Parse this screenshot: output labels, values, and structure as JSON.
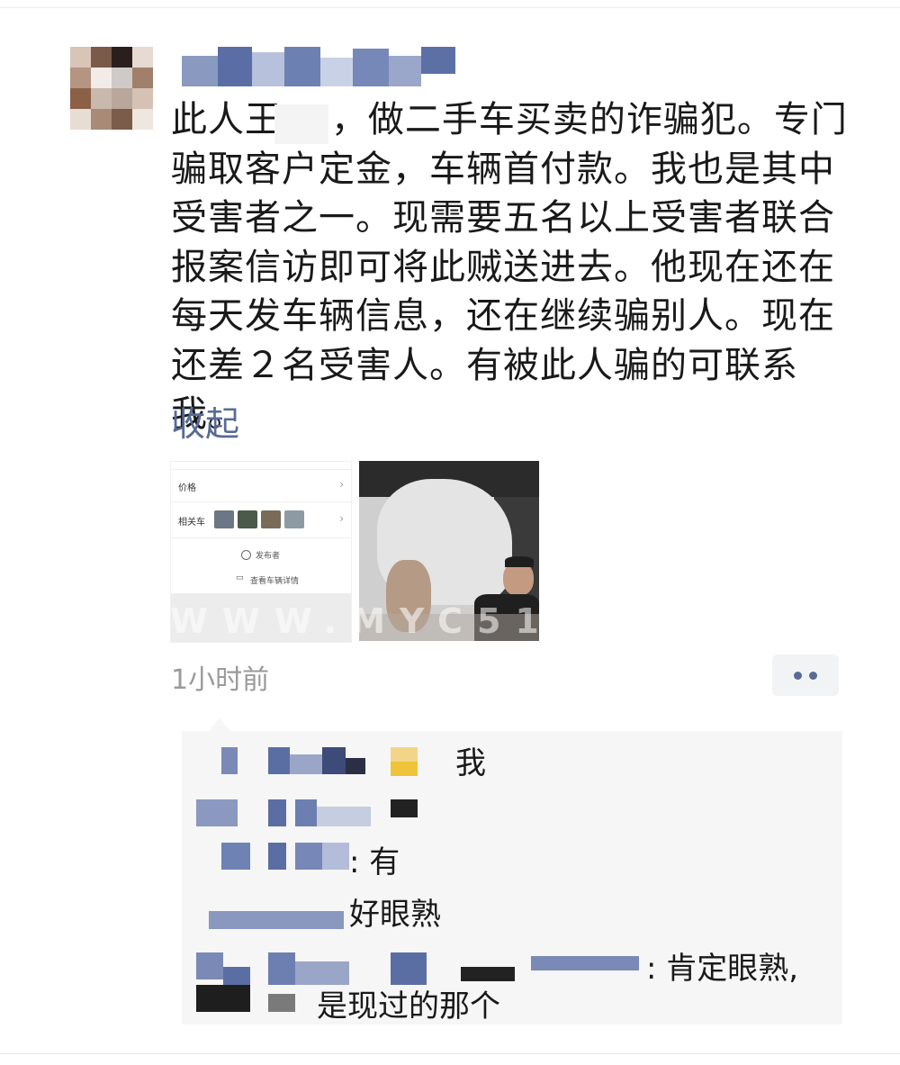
{
  "post": {
    "text": "此人王    ，做二手车买卖的诈骗犯。专门\n骗取客户定金，车辆首付款。我也是其中\n受害者之一。现需要五名以上受害者联合\n报案信访即可将此贼送进去。他现在还在\n每天发车辆信息，还在继续骗别人。现在\n还差２名受害人。有被此人骗的可联系我。",
    "collapse_label": "收起",
    "timestamp": "1小时前"
  },
  "photo1": {
    "row1_label": "价格",
    "row2_label": "相关车",
    "center1": "发布者",
    "center2": "查看车辆详情"
  },
  "watermark": "WWW.MYC51",
  "comments": {
    "c1_tail": "我",
    "c2_tail": ": 有",
    "c3_tail": "好眼熟",
    "c4_tail": ": 肯定眼熟,",
    "c5_tail": "是现过的那个"
  },
  "icons": {
    "more": "more-dots-icon",
    "avatar": "avatar-image"
  },
  "colors": {
    "link": "#576b95",
    "timestamp": "#9a9a9a",
    "comment_bg": "#f6f6f6"
  }
}
